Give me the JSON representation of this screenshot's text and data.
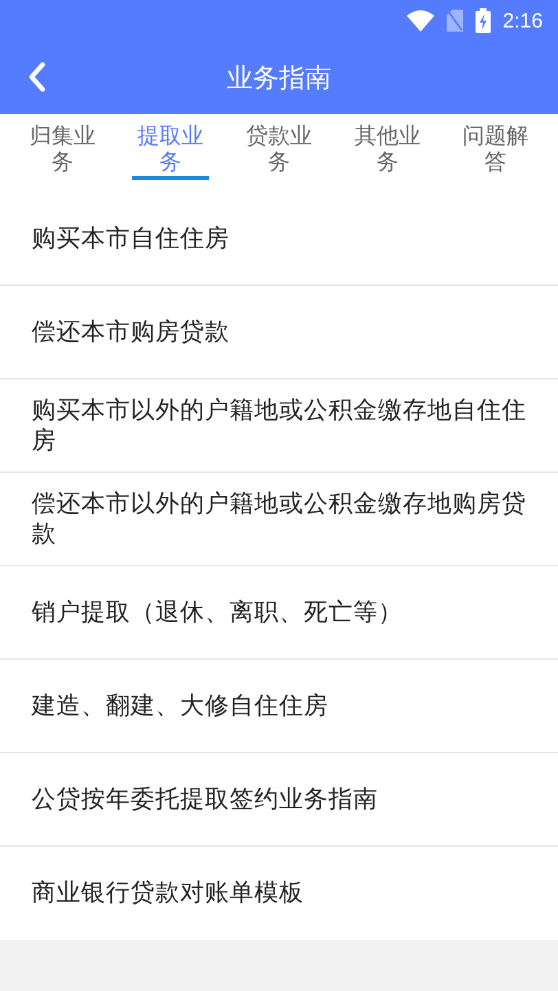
{
  "status_bar": {
    "time": "2:16"
  },
  "header": {
    "title": "业务指南"
  },
  "tabs": [
    {
      "label": "归集业务",
      "selected": false
    },
    {
      "label": "提取业务",
      "selected": true
    },
    {
      "label": "贷款业务",
      "selected": false
    },
    {
      "label": "其他业务",
      "selected": false
    },
    {
      "label": "问题解答",
      "selected": false
    }
  ],
  "items": [
    "购买本市自住住房",
    "偿还本市购房贷款",
    "购买本市以外的户籍地或公积金缴存地自住住房",
    "偿还本市以外的户籍地或公积金缴存地购房贷款",
    "销户提取（退休、离职、死亡等）",
    "建造、翻建、大修自住住房",
    "公贷按年委托提取签约业务指南",
    "商业银行贷款对账单模板"
  ]
}
